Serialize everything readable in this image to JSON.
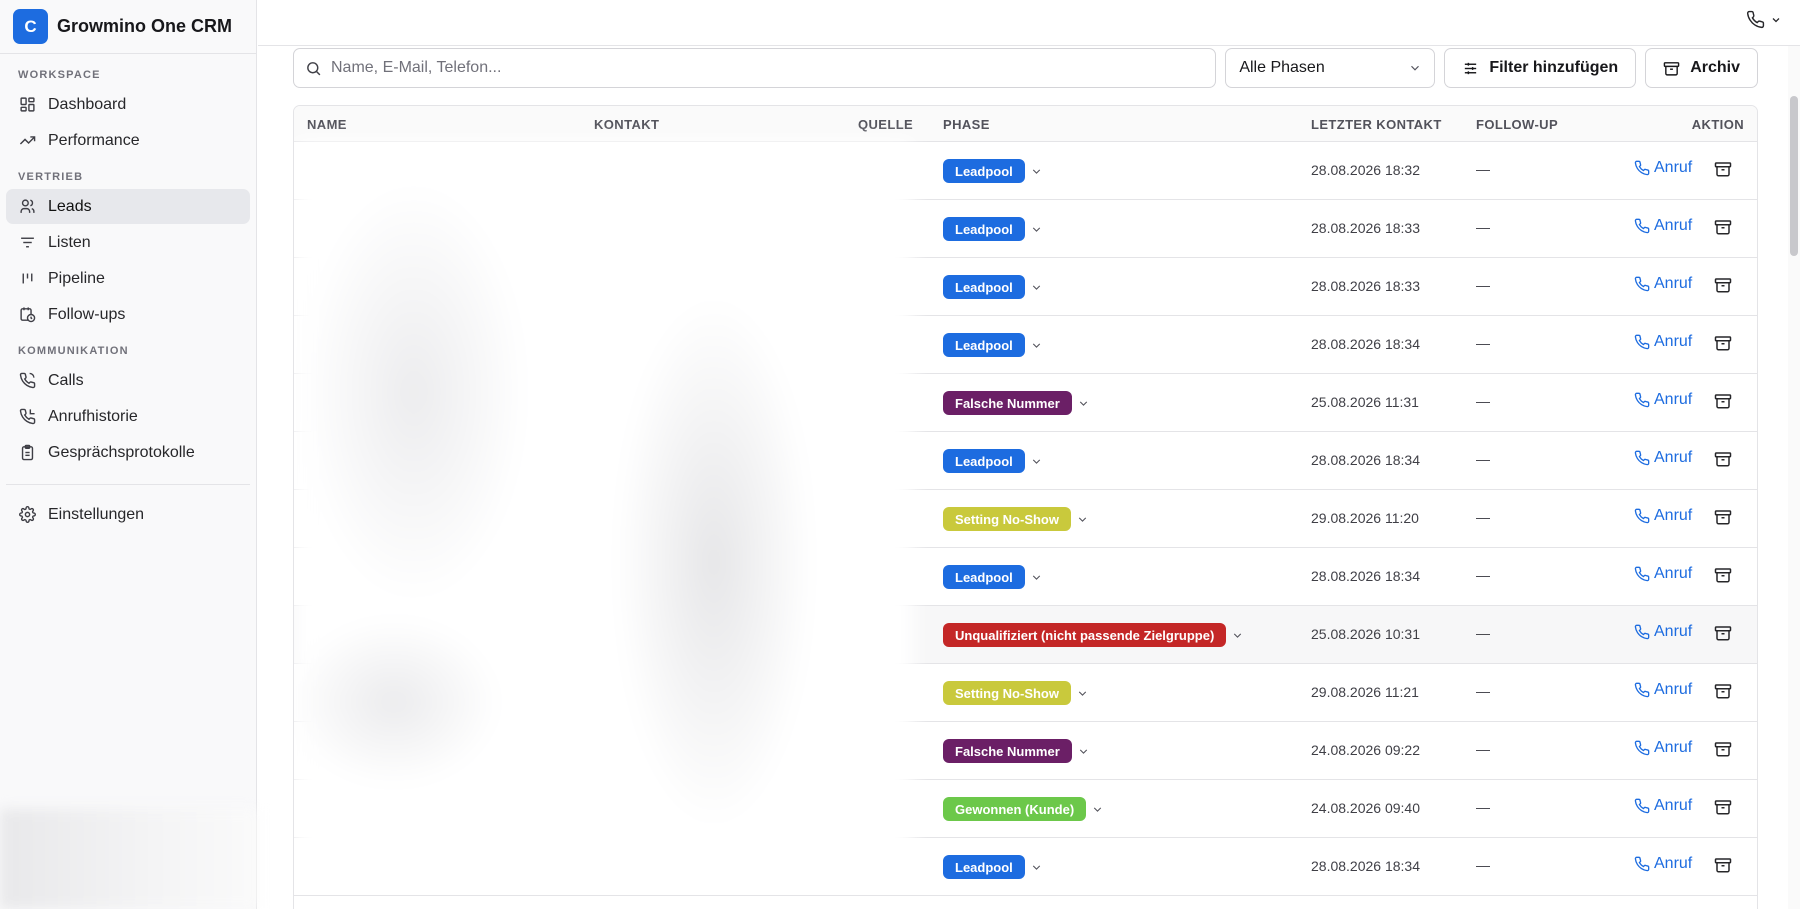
{
  "app": {
    "logo_letter": "C",
    "name": "Growmino One CRM"
  },
  "sidebar": {
    "sections": [
      {
        "label": "WORKSPACE",
        "items": [
          {
            "label": "Dashboard",
            "icon": "dashboard-icon"
          },
          {
            "label": "Performance",
            "icon": "trend-icon"
          }
        ]
      },
      {
        "label": "VERTRIEB",
        "items": [
          {
            "label": "Leads",
            "icon": "users-icon",
            "active": true
          },
          {
            "label": "Listen",
            "icon": "list-filter-icon"
          },
          {
            "label": "Pipeline",
            "icon": "pipeline-icon"
          },
          {
            "label": "Follow-ups",
            "icon": "calendar-clock-icon"
          }
        ]
      },
      {
        "label": "KOMMUNIKATION",
        "items": [
          {
            "label": "Calls",
            "icon": "phone-icon"
          },
          {
            "label": "Anrufhistorie",
            "icon": "phone-history-icon"
          },
          {
            "label": "Gesprächsprotokolle",
            "icon": "clipboard-icon"
          }
        ]
      }
    ],
    "settings": {
      "label": "Einstellungen",
      "icon": "gear-icon"
    }
  },
  "toolbar": {
    "search_placeholder": "Name, E-Mail, Telefon...",
    "phase_select": "Alle Phasen",
    "filter_label": "Filter hinzufügen",
    "archive_label": "Archiv"
  },
  "table": {
    "headers": {
      "name": "NAME",
      "kontakt": "KONTAKT",
      "quelle": "QUELLE",
      "phase": "PHASE",
      "letzter": "LETZTER KONTAKT",
      "followup": "FOLLOW-UP",
      "aktion": "AKTION"
    },
    "call_label": "Anruf",
    "rows": [
      {
        "phase": "Leadpool",
        "color": "#1d6ce0",
        "last": "28.08.2026 18:32",
        "followup": "—"
      },
      {
        "phase": "Leadpool",
        "color": "#1d6ce0",
        "last": "28.08.2026 18:33",
        "followup": "—"
      },
      {
        "phase": "Leadpool",
        "color": "#1d6ce0",
        "last": "28.08.2026 18:33",
        "followup": "—"
      },
      {
        "phase": "Leadpool",
        "color": "#1d6ce0",
        "last": "28.08.2026 18:34",
        "followup": "—"
      },
      {
        "phase": "Falsche Nummer",
        "color": "#6b1f66",
        "last": "25.08.2026 11:31",
        "followup": "—"
      },
      {
        "phase": "Leadpool",
        "color": "#1d6ce0",
        "last": "28.08.2026 18:34",
        "followup": "—"
      },
      {
        "phase": "Setting No-Show",
        "color": "#c9c93c",
        "last": "29.08.2026 11:20",
        "followup": "—"
      },
      {
        "phase": "Leadpool",
        "color": "#1d6ce0",
        "last": "28.08.2026 18:34",
        "followup": "—"
      },
      {
        "phase": "Unqualifiziert (nicht passende Zielgruppe)",
        "color": "#c42727",
        "last": "25.08.2026 10:31",
        "followup": "—",
        "highlight": true
      },
      {
        "phase": "Setting No-Show",
        "color": "#c9c93c",
        "last": "29.08.2026 11:21",
        "followup": "—"
      },
      {
        "phase": "Falsche Nummer",
        "color": "#6b1f66",
        "last": "24.08.2026 09:22",
        "followup": "—"
      },
      {
        "phase": "Gewonnen (Kunde)",
        "color": "#6cc84a",
        "last": "24.08.2026 09:40",
        "followup": "—"
      },
      {
        "phase": "Leadpool",
        "color": "#1d6ce0",
        "last": "28.08.2026 18:34",
        "followup": "—"
      }
    ]
  }
}
